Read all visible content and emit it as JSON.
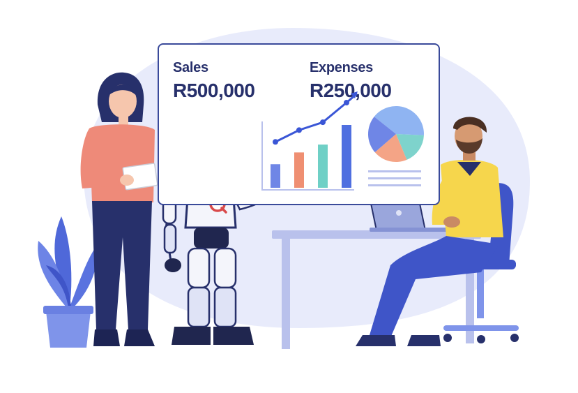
{
  "dashboard": {
    "sales": {
      "label": "Sales",
      "value": "R500,000"
    },
    "expenses": {
      "label": "Expenses",
      "value": "R250,000"
    }
  },
  "bar_chart": {
    "values": [
      30,
      45,
      55,
      80
    ],
    "colors": [
      "#6f86e6",
      "#ef8f72",
      "#6fd0c6",
      "#4f6fe0"
    ],
    "trend_color": "#3a56d6"
  },
  "pie_chart": {
    "slices": [
      {
        "value": 40,
        "color": "#8fb4f2"
      },
      {
        "value": 18,
        "color": "#7ed3cc"
      },
      {
        "value": 20,
        "color": "#f4a486"
      },
      {
        "value": 22,
        "color": "#6f86e6"
      }
    ]
  },
  "robot": {
    "chest_logo": "q-logo-icon",
    "accent": "#d94a4a"
  },
  "colors": {
    "background_blob": "#e8ebfb",
    "navy": "#27306b",
    "desk": "#b9c1ec",
    "woman_top": "#ee8a79",
    "man_shirt": "#f6d64c",
    "man_pants": "#3f55c8",
    "plant": "#4f68d9"
  }
}
